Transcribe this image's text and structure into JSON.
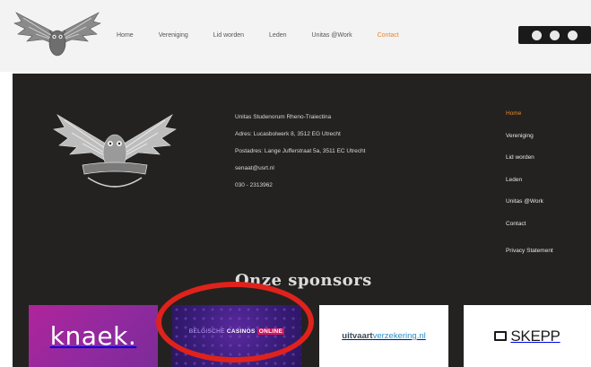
{
  "header": {
    "nav": [
      {
        "label": "Home"
      },
      {
        "label": "Vereniging"
      },
      {
        "label": "Lid worden"
      },
      {
        "label": "Leden"
      },
      {
        "label": "Unitas @Work"
      },
      {
        "label": "Contact"
      }
    ],
    "social_icons": [
      "facebook-icon",
      "instagram-icon",
      "linkedin-icon"
    ],
    "accent_color": "#e8862e"
  },
  "footer": {
    "info": [
      "Unitas Studenorum Rheno-Traiectina",
      "Adres: Lucasbolwerk 8, 3512 EG Utrecht",
      "Postadres: Lange Jufferstraat 5a, 3511 EC Utrecht",
      "senaat@usrt.nl",
      "030 - 2313962"
    ],
    "nav": [
      {
        "label": "Home"
      },
      {
        "label": "Vereniging"
      },
      {
        "label": "Lid worden"
      },
      {
        "label": "Leden"
      },
      {
        "label": "Unitas @Work"
      },
      {
        "label": "Contact"
      },
      {
        "label": "Privacy Statement"
      }
    ]
  },
  "sponsors": {
    "title": "Onze sponsors",
    "knaek": "knaek.",
    "casino": {
      "pre": "BELGISCHE",
      "main": "CASINOS",
      "highlight": "ONLINE"
    },
    "uitvaart": {
      "main": "uitvaart",
      "accent": "verzekering.nl"
    },
    "skepp": "SKEPP"
  },
  "annotation_color": "#e0221c"
}
